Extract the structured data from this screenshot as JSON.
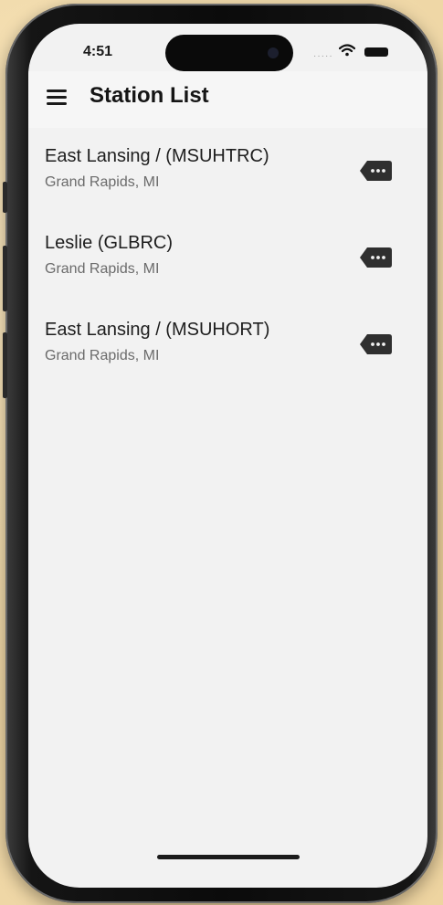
{
  "status_bar": {
    "time": "4:51",
    "signal_text": "·····",
    "icons": [
      "wifi-icon",
      "battery-icon"
    ]
  },
  "header": {
    "title": "Station List",
    "menu_icon": "menu-icon"
  },
  "stations": [
    {
      "name": "East Lansing / (MSUHTRC)",
      "location": "Grand Rapids, MI",
      "action_icon": "details-tag-icon"
    },
    {
      "name": "Leslie (GLBRC)",
      "location": "Grand Rapids, MI",
      "action_icon": "details-tag-icon"
    },
    {
      "name": "East Lansing / (MSUHORT)",
      "location": "Grand Rapids, MI",
      "action_icon": "details-tag-icon"
    }
  ],
  "colors": {
    "background": "#efd7a6",
    "screen": "#f2f2f2",
    "text_primary": "#1e1e1e",
    "text_secondary": "#6b6b6b",
    "icon": "#2f2f2f"
  }
}
